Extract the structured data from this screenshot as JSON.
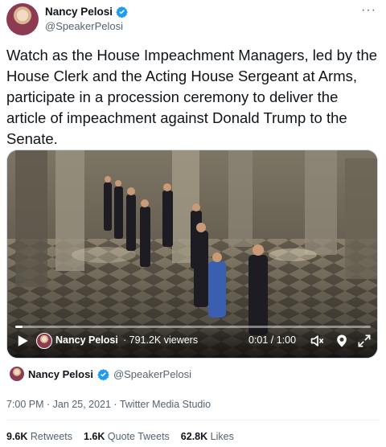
{
  "author": {
    "name": "Nancy Pelosi",
    "handle": "@SpeakerPelosi",
    "verified_color": "#1d9bf0"
  },
  "more_label": "···",
  "tweet": {
    "text": "Watch as the House Impeachment Managers, led by the House Clerk and the Acting House Sergeant at Arms, participate in a procession ceremony to deliver the article of impeachment against Donald Trump to the Senate."
  },
  "video": {
    "channel_name": "Nancy Pelosi",
    "viewers": "· 791.2K viewers",
    "time": "0:01 / 1:00",
    "progress_fraction": 0.02,
    "icons": [
      "play-icon",
      "volume-icon",
      "pip-icon",
      "fullscreen-icon"
    ]
  },
  "source": {
    "name": "Nancy Pelosi",
    "handle": "@SpeakerPelosi"
  },
  "meta": "7:00 PM · Jan 25, 2021 · Twitter Media Studio",
  "stats": [
    {
      "count": "9.6K",
      "label": "Retweets"
    },
    {
      "count": "1.6K",
      "label": "Quote Tweets"
    },
    {
      "count": "62.8K",
      "label": "Likes"
    }
  ]
}
